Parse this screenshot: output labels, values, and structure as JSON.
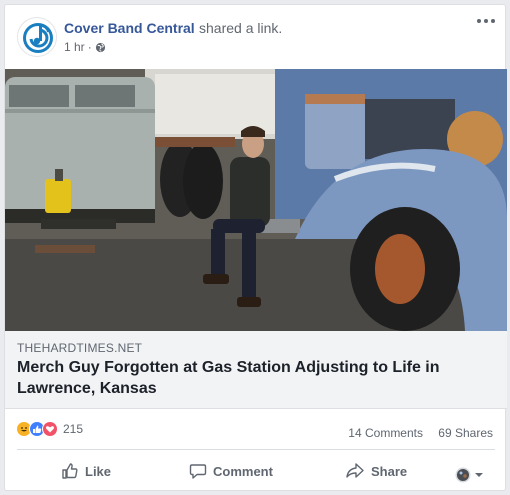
{
  "post": {
    "page_name": "Cover Band Central",
    "action_text": "shared a link.",
    "timestamp": "1 hr",
    "separator": "·"
  },
  "link": {
    "domain": "THEHARDTIMES.NET",
    "headline": "Merch Guy Forgotten at Gas Station Adjusting to Life in Lawrence, Kansas"
  },
  "engagement": {
    "reaction_count": "215",
    "comments_label": "14 Comments",
    "shares_label": "69 Shares",
    "reaction_icons": [
      "haha-icon",
      "like-icon",
      "love-icon"
    ]
  },
  "actions": {
    "like_label": "Like",
    "comment_label": "Comment",
    "share_label": "Share"
  },
  "colors": {
    "page_link": "#365899",
    "like_blue": "#4080ff",
    "love_red": "#f25268",
    "haha_yellow": "#f7b125"
  }
}
